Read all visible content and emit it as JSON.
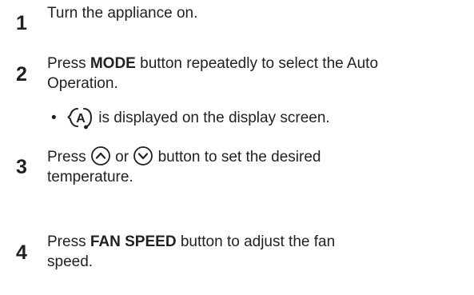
{
  "steps": [
    {
      "number": "1",
      "text": "Turn the appliance on."
    },
    {
      "number": "2",
      "prefix": "Press ",
      "bold": "MODE",
      "suffix_line1": " button repeatedly to select the Auto",
      "line2": "Operation.",
      "bullet": {
        "symbol": "•",
        "icon": "auto-mode-icon",
        "icon_letter": "A",
        "text": " is displayed on the display screen."
      }
    },
    {
      "number": "3",
      "prefix": "Press ",
      "up_icon": "chevron-up-icon",
      "middle": " or ",
      "down_icon": "chevron-down-icon",
      "suffix_line1": " button to set the desired",
      "line2": "temperature."
    },
    {
      "number": "4",
      "prefix": "Press ",
      "bold": "FAN SPEED",
      "suffix_line1": " button to adjust the fan",
      "line2": "speed."
    }
  ]
}
